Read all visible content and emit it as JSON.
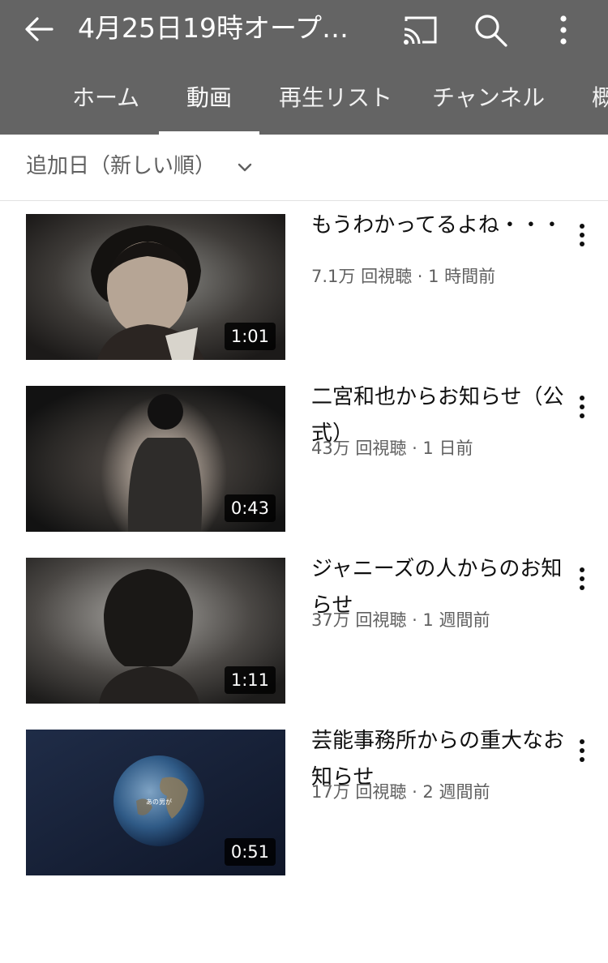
{
  "header": {
    "title": "4月25日19時オープ…",
    "icons": [
      "back-arrow-icon",
      "cast-icon",
      "search-icon",
      "more-vertical-icon"
    ]
  },
  "tabs": [
    {
      "label": "ホーム"
    },
    {
      "label": "動画"
    },
    {
      "label": "再生リスト"
    },
    {
      "label": "チャンネル"
    },
    {
      "label": "概"
    }
  ],
  "selected_tab": "動画",
  "sort": {
    "label": "追加日（新しい順）"
  },
  "videos": [
    {
      "title": "もうわかってるよね・・・",
      "meta": "7.1万 回視聴 · 1 時間前",
      "duration": "1:01"
    },
    {
      "title": "二宮和也からお知らせ（公式）",
      "meta": "43万 回視聴 · 1 日前",
      "duration": "0:43"
    },
    {
      "title": "ジャニーズの人からのお知らせ",
      "meta": "37万 回視聴 · 1 週間前",
      "duration": "1:11"
    },
    {
      "title": "芸能事務所からの重大なお知らせ",
      "meta": "17万 回視聴 · 2 週間前",
      "duration": "0:51",
      "thumb_caption": "あの男が"
    }
  ],
  "colors": {
    "appbar": "#646464",
    "text_primary": "#0f0f0f",
    "text_secondary": "#606060",
    "tab_text": "#f1f1f1",
    "background": "#ffffff"
  }
}
